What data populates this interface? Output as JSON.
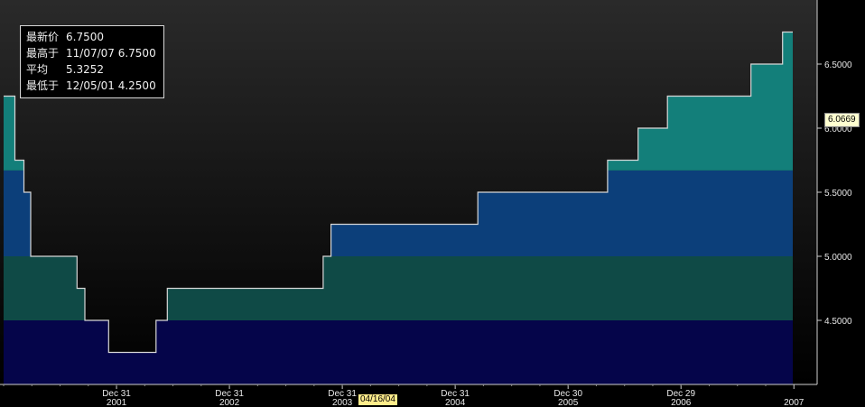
{
  "chart_data": {
    "type": "area",
    "title": "",
    "xlabel": "",
    "ylabel": "",
    "ylim": [
      4.0,
      7.0
    ],
    "y_ticks": [
      "4.5000",
      "5.0000",
      "5.5000",
      "6.0000",
      "6.5000"
    ],
    "x_ticks": [
      {
        "top": "Dec 31",
        "bottom": "2001",
        "t": 2001.0
      },
      {
        "top": "Dec 31",
        "bottom": "2002",
        "t": 2002.0
      },
      {
        "top": "Dec 31",
        "bottom": "2003",
        "t": 2003.0
      },
      {
        "top": "Dec 31",
        "bottom": "2004",
        "t": 2004.0
      },
      {
        "top": "Dec 30",
        "bottom": "2005",
        "t": 2005.0
      },
      {
        "top": "Dec 29",
        "bottom": "2006",
        "t": 2006.0
      },
      {
        "top": "",
        "bottom": "2007",
        "t": 2007.0
      }
    ],
    "series": [
      {
        "x": [
          2000.0,
          2000.1,
          2000.18,
          2000.24,
          2000.65,
          2000.72,
          2000.93,
          2001.1,
          2001.35,
          2001.45,
          2002.83,
          2002.9,
          2003.05,
          2004.2,
          2005.35,
          2005.62,
          2005.88,
          2006.62,
          2006.9,
          2006.99
        ],
        "values": [
          6.25,
          5.75,
          5.5,
          5.0,
          4.75,
          4.5,
          4.25,
          4.25,
          4.5,
          4.75,
          5.0,
          5.25,
          5.25,
          5.5,
          5.75,
          6.0,
          6.25,
          6.5,
          6.75,
          6.75
        ]
      }
    ],
    "last_value_flag": "6.0669",
    "cursor_date": "04/16/04",
    "colors": {
      "band_low": "#05054a",
      "band_mid": "#0f4a46",
      "band_blue": "#0c3f7a",
      "band_teal": "#137f7a",
      "above_line": "#1a1a1a",
      "line": "#d8d8d8"
    }
  },
  "legend": {
    "rows": [
      {
        "key": "最新价",
        "value": "6.7500"
      },
      {
        "key": "最高于",
        "value": "11/07/07 6.7500"
      },
      {
        "key": "平均",
        "value": "5.3252"
      },
      {
        "key": "最低于",
        "value": "12/05/01 4.2500"
      }
    ]
  }
}
